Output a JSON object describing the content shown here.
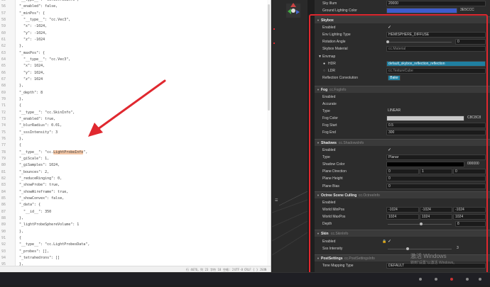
{
  "editor": {
    "line_numbers": [
      "55",
      "56",
      "57",
      "58",
      "59",
      "60",
      "61",
      "62",
      "63",
      "64",
      "65",
      "66",
      "67",
      "68",
      "69",
      "70",
      "71",
      "72",
      "73",
      "74",
      "75",
      "76",
      "77",
      "78",
      "79",
      "80",
      "81",
      "82",
      "83",
      "84",
      "85",
      "86",
      "87",
      "88",
      "89",
      "90",
      "91",
      "92",
      "93",
      "94",
      "95",
      "96",
      "97",
      "98",
      "99",
      "100",
      "101",
      "102",
      "103",
      "104"
    ],
    "lines": [
      "\"__type__\": \"cc.OctreeInfo\",",
      "\"_enabled\": false,",
      "\"_minPos\": {",
      "  \"__type__\": \"cc.Vec3\",",
      "  \"x\": -1024,",
      "  \"y\": -1024,",
      "  \"z\": -1024",
      "},",
      "\"_maxPos\": {",
      "  \"__type__\": \"cc.Vec3\",",
      "  \"x\": 1024,",
      "  \"y\": 1024,",
      "  \"z\": 1024",
      "},",
      "\"_depth\": 8",
      "},",
      "{",
      "\"__type__\": \"cc.SkinInfo\",",
      "\"_enabled\": true,",
      "\"_blurRadius\": 0.01,",
      "\"_sssIntensity\": 3",
      "},",
      "{",
      "\"__type__\": \"cc.",
      "\"_giScale\": 1,",
      "\"_giSamples\": 1024,",
      "\"_bounces\": 2,",
      "\"_reduceRinging\": 0,",
      "\"_showProbe\": true,",
      "\"_showWireframe\": true,",
      "\"_showConvex\": false,",
      "\"_data\": {",
      "  \"__id__\": 350",
      "},",
      "\"_lightProbeSphereVolume\": 1",
      "},",
      "{",
      "\"__type__\": \"cc.LightProbesData\",",
      "\"_probes\": [],",
      "\"_tetrahedrons\": []",
      "},",
      "{",
      "\"__type__\": \"cc.PostSettingsInfo\",",
      "\"_toneMappingType\": 0",
      "}",
      "]"
    ],
    "highlight": "LightProbeInfo",
    "highlight_tail": "\",",
    "status": [
      "行 4676，列 23",
      "字符 18",
      "空格: 2",
      "UTF-8",
      "CRLF",
      "{ } JSON"
    ]
  },
  "inspector": {
    "top": {
      "sky_illum_label": "Sky Illum",
      "sky_illum_value": "20000",
      "ground_label": "Ground Lighting Color",
      "ground_value": "3E5CCC"
    },
    "skybox": {
      "title": "Skybox",
      "enabled": "Enabled",
      "env_type": "Env Lighting Type",
      "env_value": "HEMISPHERE_DIFFUSE",
      "rotation": "Rotation Angle",
      "rotation_value": "0",
      "material": "Skybox Material",
      "material_value": "cc.Material",
      "envmap": "Envmap",
      "hdr": "HDR",
      "hdr_value": "default_skybox_reflection_reflection",
      "ldr": "LDR",
      "ldr_value": "cc.TextureCube",
      "reflection": "Reflection Convolution",
      "bake": "Bake"
    },
    "fog": {
      "title": "Fog",
      "cls": "cc.FogInfo",
      "enabled": "Enabled",
      "accurate": "Accurate",
      "type": "Type",
      "type_value": "LINEAR",
      "color": "Fog Color",
      "color_value": "C8C8C8",
      "start": "Fog Start",
      "start_value": "0.5",
      "end": "Fog End",
      "end_value": "300"
    },
    "shadows": {
      "title": "Shadows",
      "cls": "cc.ShadowsInfo",
      "enabled": "Enabled",
      "type": "Type",
      "type_value": "Planar",
      "color": "Shadow Color",
      "color_value": "000000",
      "direction": "Plane Direction",
      "dir_x": "0",
      "dir_y": "1",
      "dir_z": "0",
      "height": "Plane Height",
      "height_value": "0",
      "bias": "Plane Bias",
      "bias_value": "0"
    },
    "octree": {
      "title": "Octree Scene Culling",
      "cls": "cc.OctreeInfo",
      "enabled": "Enabled",
      "min": "World MinPos",
      "min_x": "-1024",
      "min_y": "-1024",
      "min_z": "-1024",
      "max": "World MaxPos",
      "max_x": "1024",
      "max_y": "1024",
      "max_z": "1024",
      "depth": "Depth",
      "depth_value": "8"
    },
    "skin": {
      "title": "Skin",
      "cls": "cc.SkinInfo",
      "enabled": "Enabled",
      "sss": "Sss Intensity",
      "sss_value": "3"
    },
    "post": {
      "title": "PostSettings",
      "cls": "cc.PostSettingsInfo",
      "tone": "Tone Mapping Type",
      "tone_value": "DEFAULT"
    }
  },
  "watermark": {
    "line1": "激活 Windows",
    "line2": "转到\"设置\"以激活 Windows。"
  },
  "colors": {
    "ground": "#3E5CCC",
    "fog": "#C8C8C8",
    "shadow": "#000000",
    "accent": "#1f7fa0",
    "annot": "#e0282f"
  }
}
